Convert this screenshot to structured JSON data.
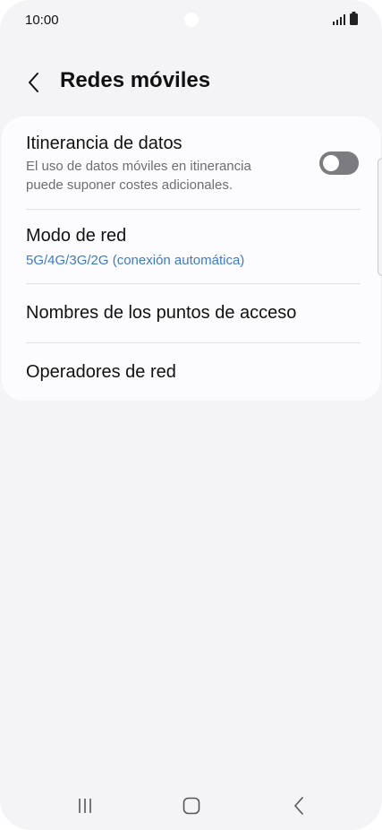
{
  "status_bar": {
    "time": "10:00",
    "icons": [
      "signal-icon",
      "battery-icon"
    ]
  },
  "header": {
    "back_icon": "chevron-left-icon",
    "title": "Redes móviles"
  },
  "settings": {
    "data_roaming": {
      "title": "Itinerancia de datos",
      "description": "El uso de datos móviles en itinerancia puede suponer costes adicionales.",
      "enabled": false
    },
    "network_mode": {
      "title": "Modo de red",
      "value": "5G/4G/3G/2G (conexión automática)"
    },
    "access_point_names": {
      "title": "Nombres de los puntos de acceso"
    },
    "network_operators": {
      "title": "Operadores de red"
    }
  },
  "nav_bar": {
    "icons": [
      "recents-icon",
      "home-icon",
      "back-icon"
    ]
  },
  "colors": {
    "background": "#f4f4f6",
    "card": "#fcfcfe",
    "accent_text": "#3c7bc4",
    "toggle_off": "#7b7b80"
  }
}
